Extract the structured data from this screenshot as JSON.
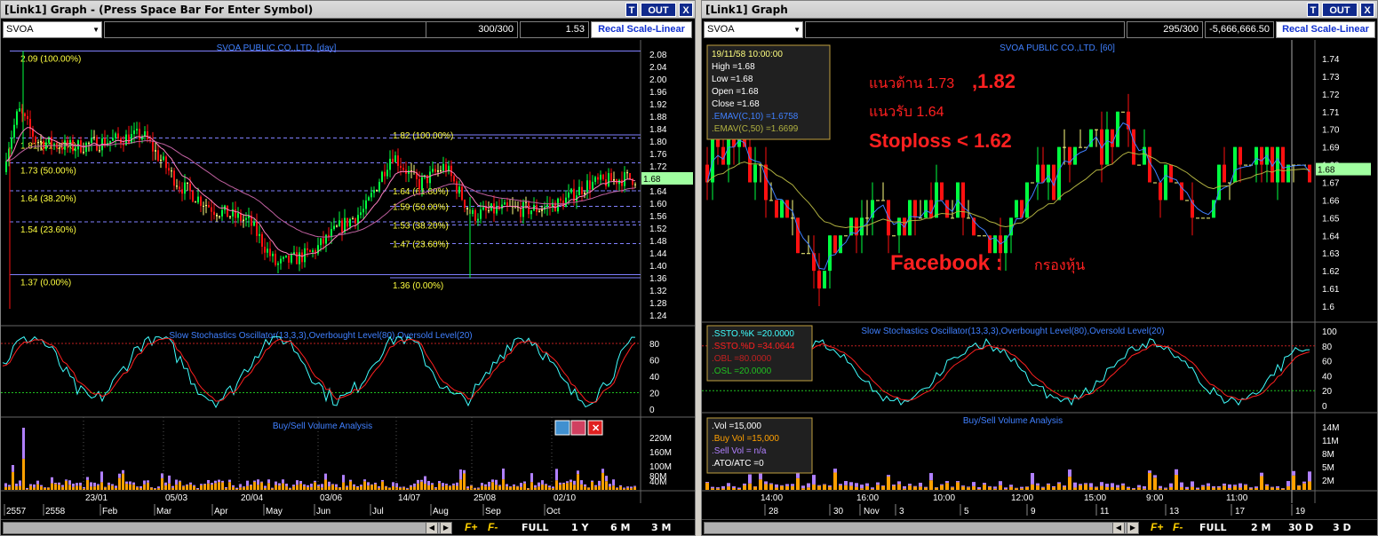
{
  "left": {
    "title": "[Link1] Graph  - (Press Space Bar For Enter Symbol)",
    "btn_t": "T",
    "btn_out": "OUT",
    "btn_x": "X",
    "symbol": "SVOA",
    "count": "300/300",
    "price": "1.53",
    "recal": "Recal Scale-Linear",
    "chart_title": "SVOA PUBLIC CO.,LTD. [day]",
    "last_price": "1.68",
    "fib_a": [
      "2.09 (100.00%)",
      "1.81 (61.80%)",
      "1.73 (50.00%)",
      "1.64 (38.20%)",
      "1.54 (23.60%)",
      "1.37 (0.00%)"
    ],
    "fib_b": [
      "1.82 (100.00%)",
      "1.64 (61.80%)",
      "1.59 (50.00%)",
      "1.53 (38.20%)",
      "1.47 (23.60%)",
      "1.36 (0.00%)"
    ],
    "yticks": [
      "2.08",
      "2.04",
      "2.00",
      "1.96",
      "1.92",
      "1.88",
      "1.84",
      "1.80",
      "1.76",
      "1.72",
      "1.68",
      "1.64",
      "1.60",
      "1.56",
      "1.52",
      "1.48",
      "1.44",
      "1.40",
      "1.36",
      "1.32",
      "1.28",
      "1.24"
    ],
    "stoch_title": "Slow Stochastics Oscillator(13,3,3),Overbought Level(80),Oversold Level(20)",
    "stoch_ticks": [
      "80",
      "60",
      "40",
      "20",
      "0"
    ],
    "vol_title": "Buy/Sell Volume Analysis",
    "vol_ticks": [
      "220M",
      "160M",
      "100M",
      "80M",
      "40M"
    ],
    "xlabels_top": [
      "23/01",
      "05/03",
      "20/04",
      "03/06",
      "14/07",
      "25/08",
      "02/10"
    ],
    "xlabels_bottom": [
      "2557",
      "2558",
      "Feb",
      "Mar",
      "Apr",
      "May",
      "Jun",
      "Jul",
      "Aug",
      "Sep",
      "Oct"
    ],
    "periods": [
      "FULL",
      "1 Y",
      "6 M",
      "3 M"
    ],
    "f_plus": "F+",
    "f_minus": "F-"
  },
  "right": {
    "title": "[Link1] Graph",
    "btn_t": "T",
    "btn_out": "OUT",
    "btn_x": "X",
    "symbol": "SVOA",
    "count": "295/300",
    "price": "-5,666,666.50",
    "recal": "Recal Scale-Linear",
    "chart_title": "SVOA PUBLIC CO.,LTD. [60]",
    "last_price": "1.68",
    "info": [
      "19/11/58 10:00:00",
      "High  =1.68",
      "Low  =1.68",
      "Open  =1.68",
      "Close  =1.68",
      ".EMAV(C,10)   =1.6758",
      ".EMAV(C,50)   =1.6699"
    ],
    "annot_resist": "แนวต้าน 1.73",
    "annot_resist2": ",1.82",
    "annot_support": "แนวรับ 1.64",
    "annot_stop": "Stoploss < 1.62",
    "annot_fb": "Facebook :",
    "annot_fb2": "กรองหุ้น",
    "yticks": [
      "1.74",
      "1.73",
      "1.72",
      "1.71",
      "1.70",
      "1.69",
      "1.68",
      "1.67",
      "1.66",
      "1.65",
      "1.64",
      "1.63",
      "1.62",
      "1.61",
      "1.6"
    ],
    "stoch_title": "Slow Stochastics Oscillator(13,3,3),Overbought Level(80),Oversold Level(20)",
    "stoch_info": [
      ".SSTO.%K    =20.0000",
      ".SSTO.%D    =34.0644",
      ".OBL    =80.0000",
      ".OSL    =20.0000"
    ],
    "stoch_ticks": [
      "100",
      "80",
      "60",
      "40",
      "20",
      "0"
    ],
    "vol_title": "Buy/Sell Volume Analysis",
    "vol_info": [
      ".Vol    =15,000",
      ".Buy Vol    =15,000",
      ".Sell Vol    = n/a",
      ".ATO/ATC    =0"
    ],
    "vol_ticks": [
      "14M",
      "11M",
      "8M",
      "5M",
      "2M"
    ],
    "xlabels_top": [
      "14:00",
      "16:00",
      "10:00",
      "12:00",
      "15:00",
      "9:00",
      "11:00"
    ],
    "xlabels_bottom": [
      "28",
      "30",
      "Nov",
      "3",
      "5",
      "9",
      "11",
      "13",
      "17",
      "19"
    ],
    "periods": [
      "FULL",
      "2 M",
      "30 D",
      "3 D"
    ],
    "f_plus": "F+",
    "f_minus": "F-"
  },
  "colors": {
    "up": "#00ff40",
    "down": "#ff1010",
    "doji": "#ffff80",
    "fib": "#8080ff",
    "pink": "#ff80c0",
    "cyan": "#40ffff",
    "stoch_d": "#ff2020",
    "buy": "#ffa000",
    "sell": "#b080ff",
    "title_blue": "#4080ff",
    "annot": "#ff2020"
  }
}
